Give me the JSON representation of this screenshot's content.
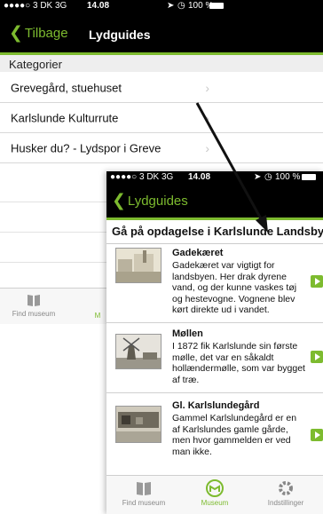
{
  "colors": {
    "accent": "#7dbb2f",
    "bar": "#000000",
    "section_bg": "#eeeeee"
  },
  "back_screen": {
    "status": {
      "carrier": "●●●●○ 3 DK  3G",
      "time": "14.08",
      "battery": "100 %"
    },
    "nav": {
      "back_label": "Tilbage",
      "title": "Lydguides"
    },
    "section_header": "Kategorier",
    "rows": [
      {
        "label": "Grevegård, stuehuset"
      },
      {
        "label": "Karlslunde Kulturrute"
      },
      {
        "label": "Husker du? - Lydspor i Greve"
      }
    ],
    "tabs": [
      {
        "label": "Find museum",
        "icon": "book-icon"
      },
      {
        "label": "M",
        "icon": "museum-icon"
      }
    ]
  },
  "front_screen": {
    "status": {
      "carrier": "●●●●○ 3 DK  3G",
      "time": "14.08",
      "battery": "100 %"
    },
    "nav": {
      "back_label": "Lydguides"
    },
    "section_header": "Gå på opdagelse i Karlslunde Landsby",
    "items": [
      {
        "title": "Gadekæret",
        "text": "Gadekæret var vigtigt for landsbyen. Her drak dyrene vand, og der kunne vaskes tøj og hestevogne. Vognene blev kørt direkte ud i vandet."
      },
      {
        "title": "Møllen",
        "text": "I 1872 fik Karlslunde sin første mølle, det var en såkaldt hollændermølle, som var bygget af træ."
      },
      {
        "title": "Gl. Karlslundegård",
        "text": "Gammel Karlslundegård er en af Karlslundes gamle gårde, men hvor gammelden er ved man ikke."
      }
    ],
    "tabs": [
      {
        "label": "Find museum",
        "icon": "book-icon"
      },
      {
        "label": "Museum",
        "icon": "museum-icon"
      },
      {
        "label": "Indstillinger",
        "icon": "gear-icon"
      }
    ]
  }
}
